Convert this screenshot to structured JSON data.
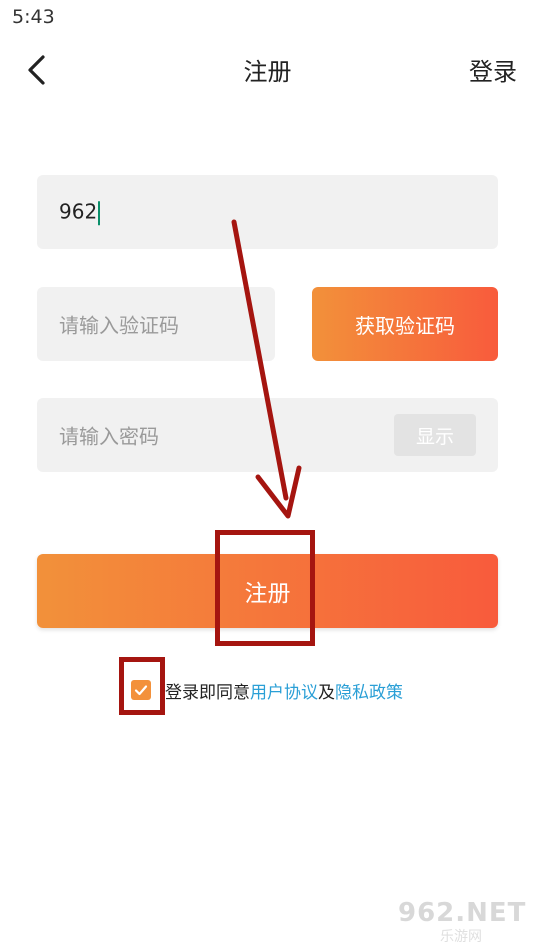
{
  "status_bar": {
    "time": "5:43"
  },
  "header": {
    "title": "注册",
    "login_label": "登录"
  },
  "form": {
    "phone_value": "962",
    "code_placeholder": "请输入验证码",
    "get_code_label": "获取验证码",
    "password_placeholder": "请输入密码",
    "show_label": "显示",
    "register_label": "注册"
  },
  "agreement": {
    "checked": true,
    "prefix": "登录即同意",
    "user_agreement": "用户协议",
    "conjunction": "及",
    "privacy_policy": "隐私政策"
  },
  "watermark": {
    "main": "962.NET",
    "sub": "乐游网"
  },
  "colors": {
    "accent_start": "#f2913a",
    "accent_end": "#f85b3c",
    "link": "#2a9fd6",
    "annotation": "#a51510"
  },
  "icons": {
    "back": "chevron-left-icon",
    "check": "checkmark-icon"
  }
}
